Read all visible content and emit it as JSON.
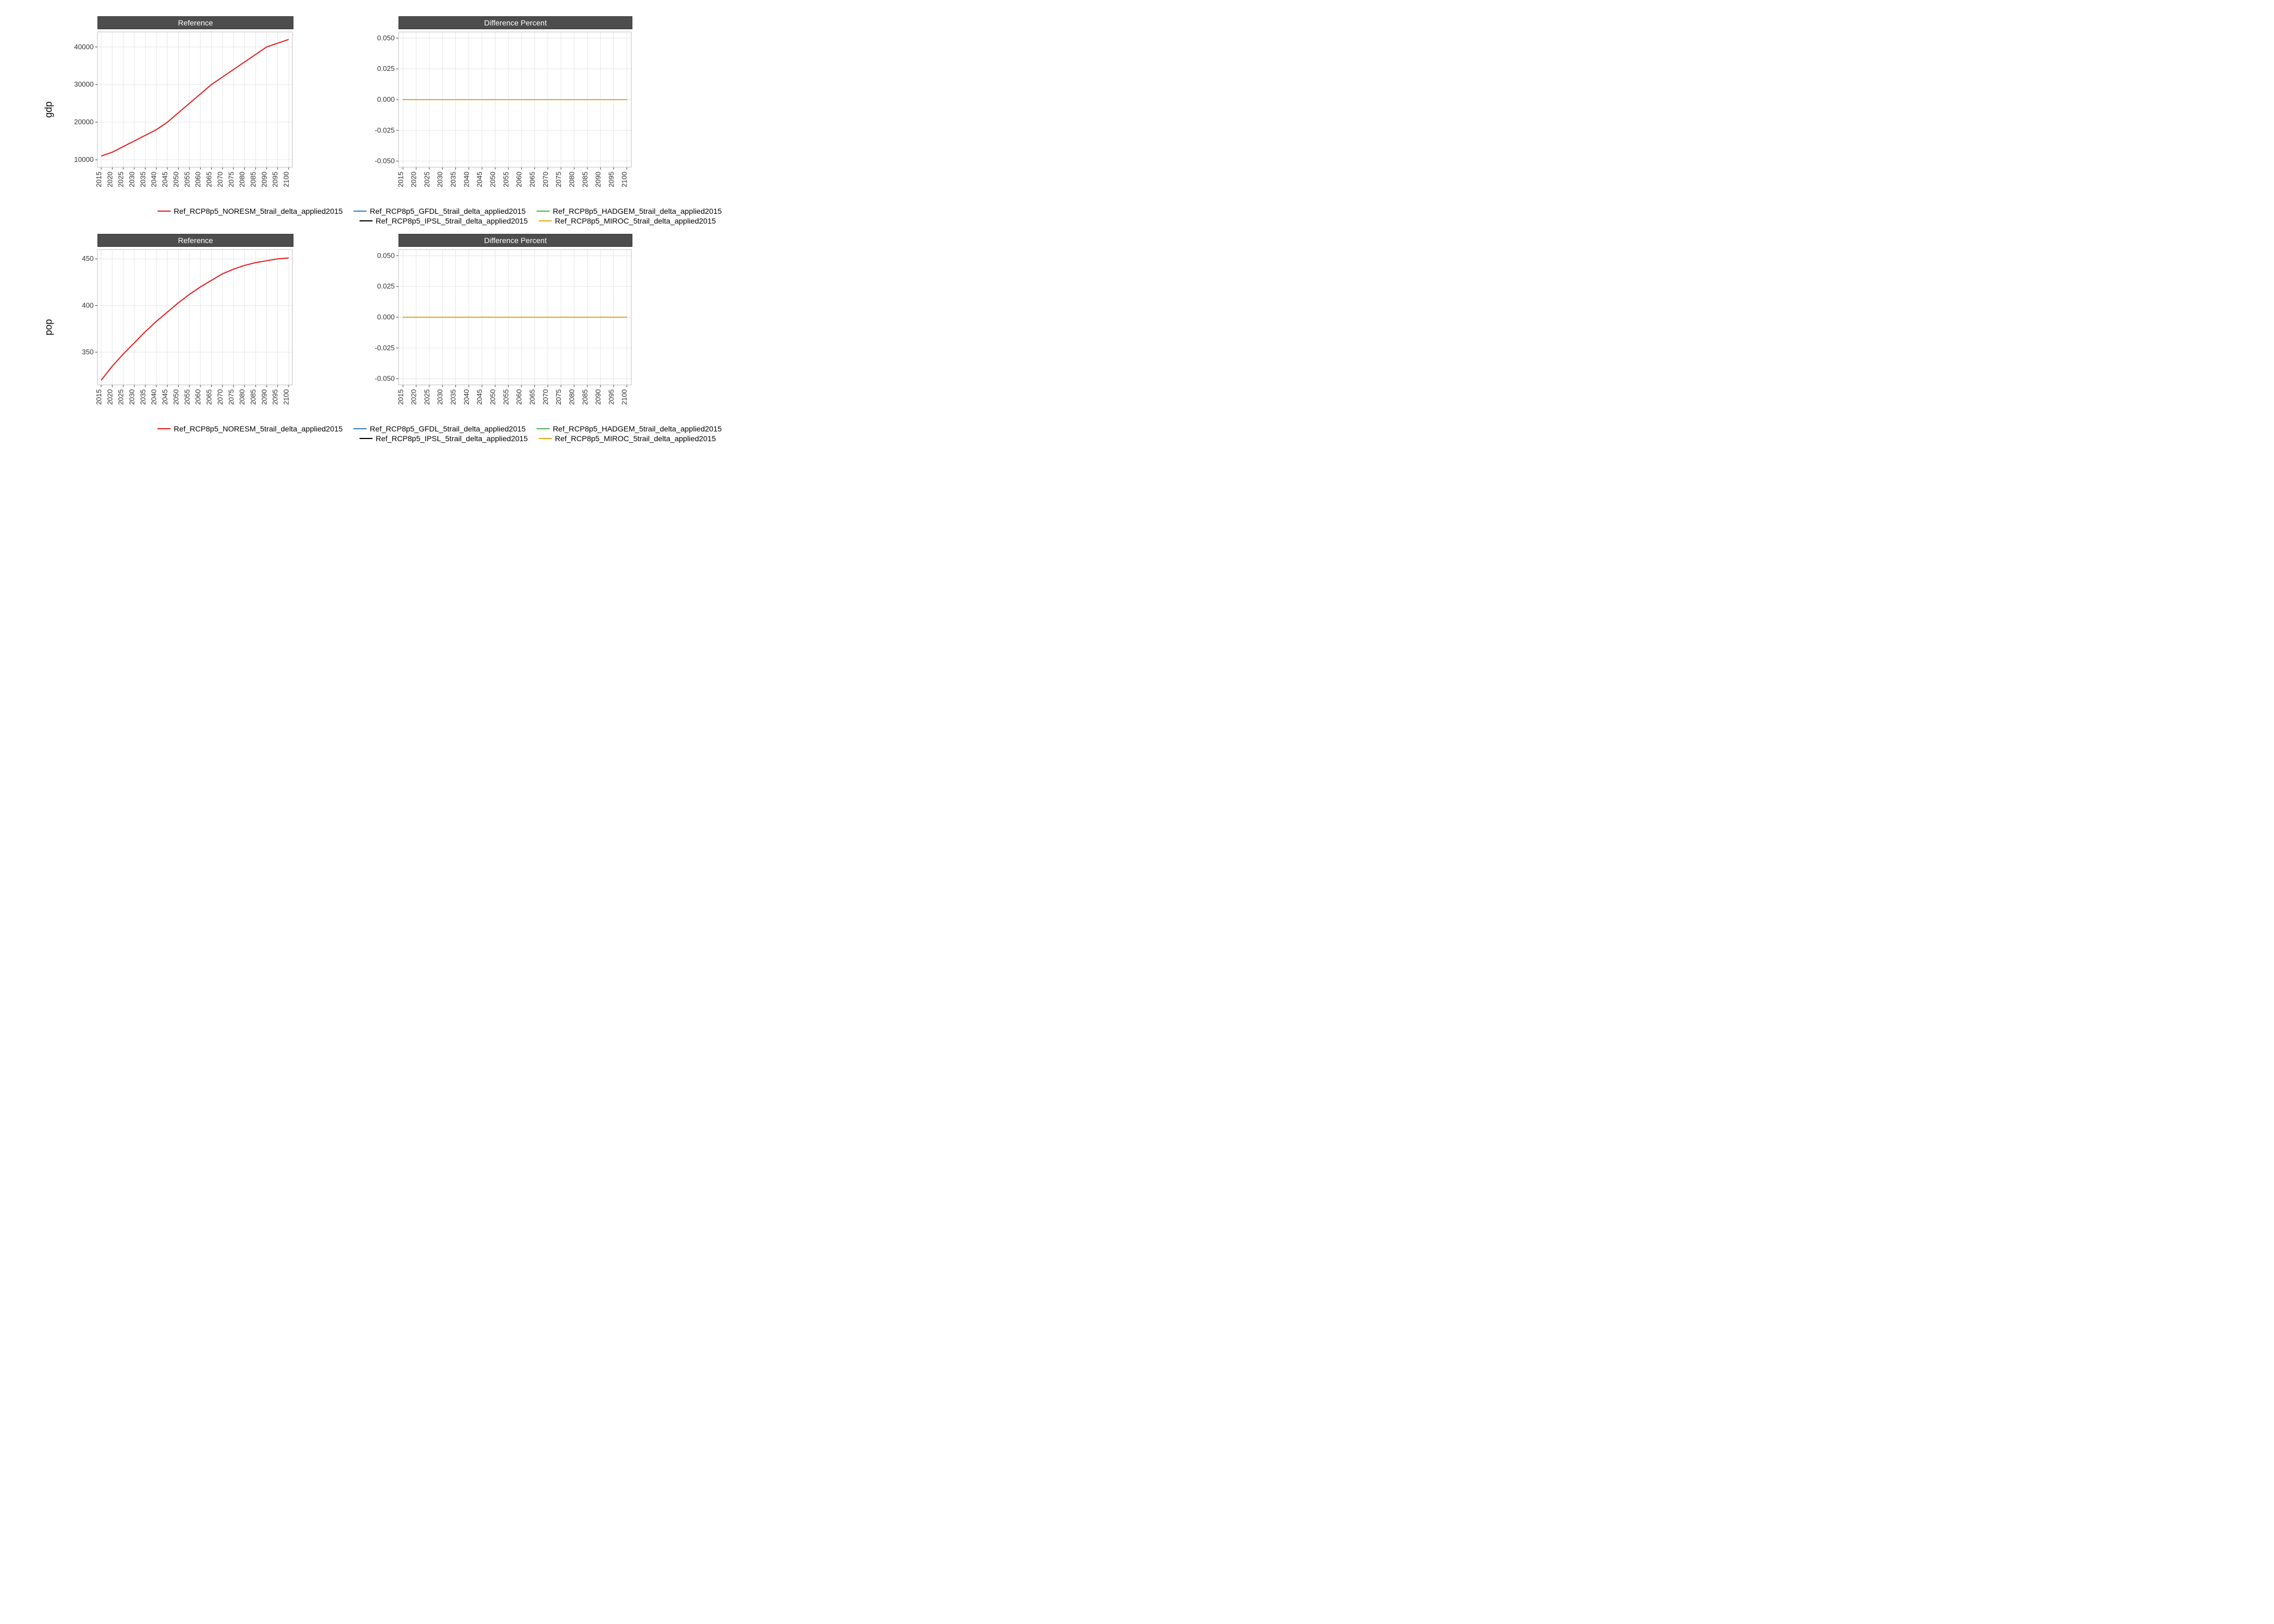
{
  "legend_series": [
    {
      "name": "Ref_RCP8p5_NORESM_5trail_delta_applied2015",
      "color": "#e41a1c"
    },
    {
      "name": "Ref_RCP8p5_GFDL_5trail_delta_applied2015",
      "color": "#377eb8"
    },
    {
      "name": "Ref_RCP8p5_HADGEM_5trail_delta_applied2015",
      "color": "#4daf4a"
    },
    {
      "name": "Ref_RCP8p5_IPSL_5trail_delta_applied2015",
      "color": "#000000"
    },
    {
      "name": "Ref_RCP8p5_MIROC_5trail_delta_applied2015",
      "color": "#e6a817"
    }
  ],
  "x_ticks": [
    2015,
    2020,
    2025,
    2030,
    2035,
    2040,
    2045,
    2050,
    2055,
    2060,
    2065,
    2070,
    2075,
    2080,
    2085,
    2090,
    2095,
    2100
  ],
  "rows": [
    {
      "ylabel": "gdp",
      "panels": [
        {
          "title": "Reference",
          "y_ticks": [
            10000,
            20000,
            30000,
            40000
          ],
          "y_tick_fmt": "int",
          "ylim": [
            8000,
            44000
          ],
          "lines": [
            {
              "series": 0,
              "y": [
                11000,
                12000,
                13500,
                15000,
                16500,
                18000,
                20000,
                22500,
                25000,
                27500,
                30000,
                32000,
                34000,
                36000,
                38000,
                40000,
                41000,
                42000
              ]
            }
          ]
        },
        {
          "title": "Difference Percent",
          "y_ticks": [
            -0.05,
            -0.025,
            0.0,
            0.025,
            0.05
          ],
          "y_tick_fmt": "dec3",
          "ylim": [
            -0.055,
            0.055
          ],
          "lines": [
            {
              "series": 1,
              "y": [
                0,
                0,
                0,
                0,
                0,
                0,
                0,
                0,
                0,
                0,
                0,
                0,
                0,
                0,
                0,
                0,
                0,
                0
              ]
            },
            {
              "series": 2,
              "y": [
                0,
                0,
                0,
                0,
                0,
                0,
                0,
                0,
                0,
                0,
                0,
                0,
                0,
                0,
                0,
                0,
                0,
                0
              ]
            },
            {
              "series": 3,
              "y": [
                0,
                0,
                0,
                0,
                0,
                0,
                0,
                0,
                0,
                0,
                0,
                0,
                0,
                0,
                0,
                0,
                0,
                0
              ]
            },
            {
              "series": 4,
              "y": [
                0,
                0,
                0,
                0,
                0,
                0,
                0,
                0,
                0,
                0,
                0,
                0,
                0,
                0,
                0,
                0,
                0,
                0
              ]
            }
          ]
        }
      ]
    },
    {
      "ylabel": "pop",
      "panels": [
        {
          "title": "Reference",
          "y_ticks": [
            350,
            400,
            450
          ],
          "y_tick_fmt": "int",
          "ylim": [
            315,
            460
          ],
          "lines": [
            {
              "series": 0,
              "y": [
                320,
                335,
                348,
                360,
                372,
                383,
                393,
                403,
                412,
                420,
                427,
                434,
                439,
                443,
                446,
                448,
                450,
                451
              ]
            }
          ]
        },
        {
          "title": "Difference Percent",
          "y_ticks": [
            -0.05,
            -0.025,
            0.0,
            0.025,
            0.05
          ],
          "y_tick_fmt": "dec3",
          "ylim": [
            -0.055,
            0.055
          ],
          "lines": [
            {
              "series": 1,
              "y": [
                0,
                0,
                0,
                0,
                0,
                0,
                0,
                0,
                0,
                0,
                0,
                0,
                0,
                0,
                0,
                0,
                0,
                0
              ]
            },
            {
              "series": 2,
              "y": [
                0,
                0,
                0,
                0,
                0,
                0,
                0,
                0,
                0,
                0,
                0,
                0,
                0,
                0,
                0,
                0,
                0,
                0
              ]
            },
            {
              "series": 3,
              "y": [
                0,
                0,
                0,
                0,
                0,
                0,
                0,
                0,
                0,
                0,
                0,
                0,
                0,
                0,
                0,
                0,
                0,
                0
              ]
            },
            {
              "series": 4,
              "y": [
                0,
                0,
                0,
                0,
                0,
                0,
                0,
                0,
                0,
                0,
                0,
                0,
                0,
                0,
                0,
                0,
                0,
                0
              ]
            }
          ]
        }
      ]
    }
  ],
  "chart_data": [
    {
      "type": "line",
      "title": "Reference",
      "ylabel": "gdp",
      "xlabel": "",
      "x": [
        2015,
        2020,
        2025,
        2030,
        2035,
        2040,
        2045,
        2050,
        2055,
        2060,
        2065,
        2070,
        2075,
        2080,
        2085,
        2090,
        2095,
        2100
      ],
      "ylim": [
        10000,
        42000
      ],
      "series": [
        {
          "name": "Ref_RCP8p5_NORESM_5trail_delta_applied2015",
          "values": [
            11000,
            12000,
            13500,
            15000,
            16500,
            18000,
            20000,
            22500,
            25000,
            27500,
            30000,
            32000,
            34000,
            36000,
            38000,
            40000,
            41000,
            42000
          ]
        }
      ]
    },
    {
      "type": "line",
      "title": "Difference Percent",
      "ylabel": "gdp",
      "xlabel": "",
      "x": [
        2015,
        2020,
        2025,
        2030,
        2035,
        2040,
        2045,
        2050,
        2055,
        2060,
        2065,
        2070,
        2075,
        2080,
        2085,
        2090,
        2095,
        2100
      ],
      "ylim": [
        -0.05,
        0.05
      ],
      "series": [
        {
          "name": "Ref_RCP8p5_GFDL_5trail_delta_applied2015",
          "values": [
            0,
            0,
            0,
            0,
            0,
            0,
            0,
            0,
            0,
            0,
            0,
            0,
            0,
            0,
            0,
            0,
            0,
            0
          ]
        },
        {
          "name": "Ref_RCP8p5_HADGEM_5trail_delta_applied2015",
          "values": [
            0,
            0,
            0,
            0,
            0,
            0,
            0,
            0,
            0,
            0,
            0,
            0,
            0,
            0,
            0,
            0,
            0,
            0
          ]
        },
        {
          "name": "Ref_RCP8p5_IPSL_5trail_delta_applied2015",
          "values": [
            0,
            0,
            0,
            0,
            0,
            0,
            0,
            0,
            0,
            0,
            0,
            0,
            0,
            0,
            0,
            0,
            0,
            0
          ]
        },
        {
          "name": "Ref_RCP8p5_MIROC_5trail_delta_applied2015",
          "values": [
            0,
            0,
            0,
            0,
            0,
            0,
            0,
            0,
            0,
            0,
            0,
            0,
            0,
            0,
            0,
            0,
            0,
            0
          ]
        }
      ]
    },
    {
      "type": "line",
      "title": "Reference",
      "ylabel": "pop",
      "xlabel": "",
      "x": [
        2015,
        2020,
        2025,
        2030,
        2035,
        2040,
        2045,
        2050,
        2055,
        2060,
        2065,
        2070,
        2075,
        2080,
        2085,
        2090,
        2095,
        2100
      ],
      "ylim": [
        320,
        451
      ],
      "series": [
        {
          "name": "Ref_RCP8p5_NORESM_5trail_delta_applied2015",
          "values": [
            320,
            335,
            348,
            360,
            372,
            383,
            393,
            403,
            412,
            420,
            427,
            434,
            439,
            443,
            446,
            448,
            450,
            451
          ]
        }
      ]
    },
    {
      "type": "line",
      "title": "Difference Percent",
      "ylabel": "pop",
      "xlabel": "",
      "x": [
        2015,
        2020,
        2025,
        2030,
        2035,
        2040,
        2045,
        2050,
        2055,
        2060,
        2065,
        2070,
        2075,
        2080,
        2085,
        2090,
        2095,
        2100
      ],
      "ylim": [
        -0.05,
        0.05
      ],
      "series": [
        {
          "name": "Ref_RCP8p5_GFDL_5trail_delta_applied2015",
          "values": [
            0,
            0,
            0,
            0,
            0,
            0,
            0,
            0,
            0,
            0,
            0,
            0,
            0,
            0,
            0,
            0,
            0,
            0
          ]
        },
        {
          "name": "Ref_RCP8p5_HADGEM_5trail_delta_applied2015",
          "values": [
            0,
            0,
            0,
            0,
            0,
            0,
            0,
            0,
            0,
            0,
            0,
            0,
            0,
            0,
            0,
            0,
            0,
            0
          ]
        },
        {
          "name": "Ref_RCP8p5_IPSL_5trail_delta_applied2015",
          "values": [
            0,
            0,
            0,
            0,
            0,
            0,
            0,
            0,
            0,
            0,
            0,
            0,
            0,
            0,
            0,
            0,
            0,
            0
          ]
        },
        {
          "name": "Ref_RCP8p5_MIROC_5trail_delta_applied2015",
          "values": [
            0,
            0,
            0,
            0,
            0,
            0,
            0,
            0,
            0,
            0,
            0,
            0,
            0,
            0,
            0,
            0,
            0,
            0
          ]
        }
      ]
    }
  ]
}
